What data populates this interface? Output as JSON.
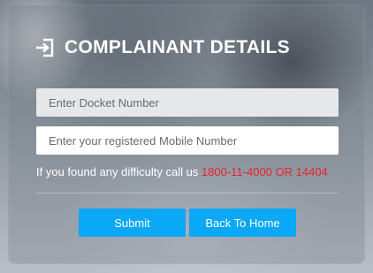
{
  "header": {
    "title": "COMPLAINANT DETAILS",
    "icon": "sign-in-icon"
  },
  "form": {
    "docket_placeholder": "Enter Docket Number",
    "docket_value": "",
    "mobile_placeholder": "Enter your registered Mobile Number",
    "mobile_value": ""
  },
  "help": {
    "text": "If you found any difficulty call us ",
    "phone": "1800-11-4000 OR 14404"
  },
  "buttons": {
    "submit_label": "Submit",
    "home_label": "Back To Home"
  },
  "colors": {
    "accent": "#0aa8f6",
    "phone": "#e8262a"
  }
}
